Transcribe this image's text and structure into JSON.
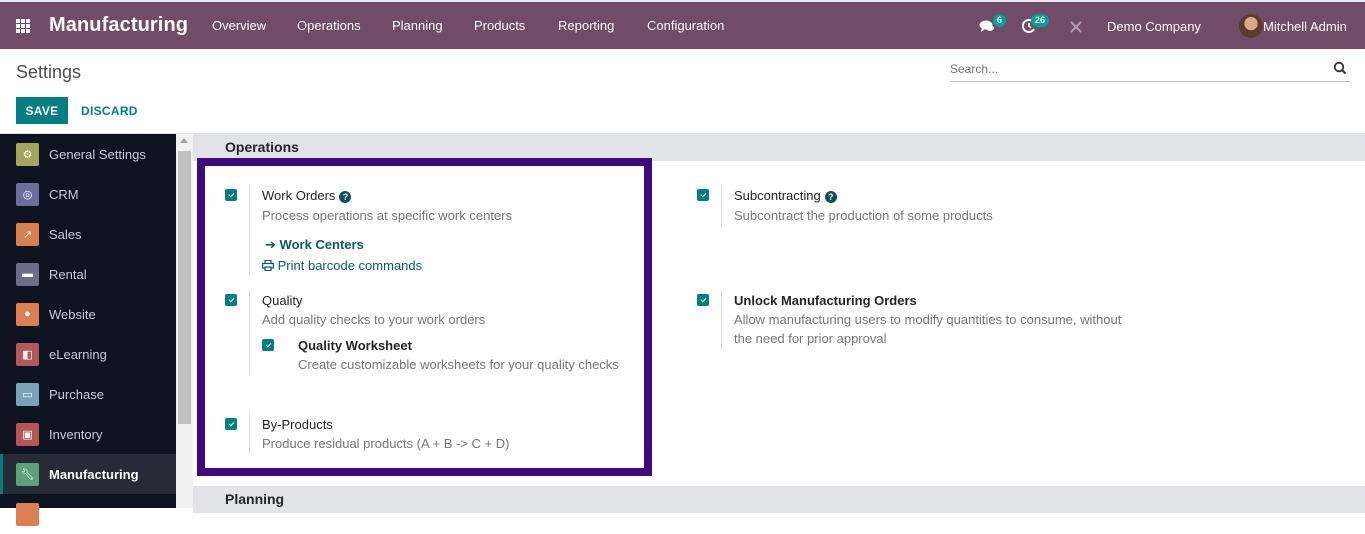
{
  "topbar": {
    "app_name": "Manufacturing",
    "nav": [
      "Overview",
      "Operations",
      "Planning",
      "Products",
      "Reporting",
      "Configuration"
    ],
    "messages_count": "6",
    "activities_count": "26",
    "company": "Demo Company",
    "user": "Mitchell Admin"
  },
  "control": {
    "title": "Settings",
    "search_placeholder": "Search...",
    "save_label": "SAVE",
    "discard_label": "DISCARD"
  },
  "sidebar": {
    "items": [
      {
        "label": "General Settings",
        "icon": "gear-icon",
        "color": "#a5a45c"
      },
      {
        "label": "CRM",
        "icon": "handshake-icon",
        "color": "#6c6f9e"
      },
      {
        "label": "Sales",
        "icon": "chart-icon",
        "color": "#d9814e"
      },
      {
        "label": "Rental",
        "icon": "rental-icon",
        "color": "#6b6e88"
      },
      {
        "label": "Website",
        "icon": "globe-icon",
        "color": "#dd7e55"
      },
      {
        "label": "eLearning",
        "icon": "elearning-icon",
        "color": "#b25a5a"
      },
      {
        "label": "Purchase",
        "icon": "card-icon",
        "color": "#7aa2b8"
      },
      {
        "label": "Inventory",
        "icon": "box-icon",
        "color": "#b45656"
      },
      {
        "label": "Manufacturing",
        "icon": "wrench-icon",
        "color": "#5fa07a",
        "active": true
      }
    ]
  },
  "sections": {
    "operations": "Operations",
    "planning": "Planning"
  },
  "settings": {
    "work_orders": {
      "title": "Work Orders",
      "desc": "Process operations at specific work centers",
      "checked": true,
      "link1": "Work Centers",
      "link2": "Print barcode commands"
    },
    "quality": {
      "title": "Quality",
      "desc": "Add quality checks to your work orders",
      "checked": true
    },
    "quality_worksheet": {
      "title": "Quality Worksheet",
      "desc": "Create customizable worksheets for your quality checks",
      "checked": true
    },
    "by_products": {
      "title": "By-Products",
      "desc": "Produce residual products (A + B -> C + D)",
      "checked": true
    },
    "subcontracting": {
      "title": "Subcontracting",
      "desc": "Subcontract the production of some products",
      "checked": true
    },
    "unlock_mo": {
      "title": "Unlock Manufacturing Orders",
      "desc1": "Allow manufacturing users to modify quantities to consume, without",
      "desc2": "the need for prior approval",
      "checked": true
    }
  },
  "colors": {
    "topbar": "#714b67",
    "primary": "#017e84",
    "highlight_border": "#3e0a7e",
    "sidebar_bg": "#0d1321"
  }
}
